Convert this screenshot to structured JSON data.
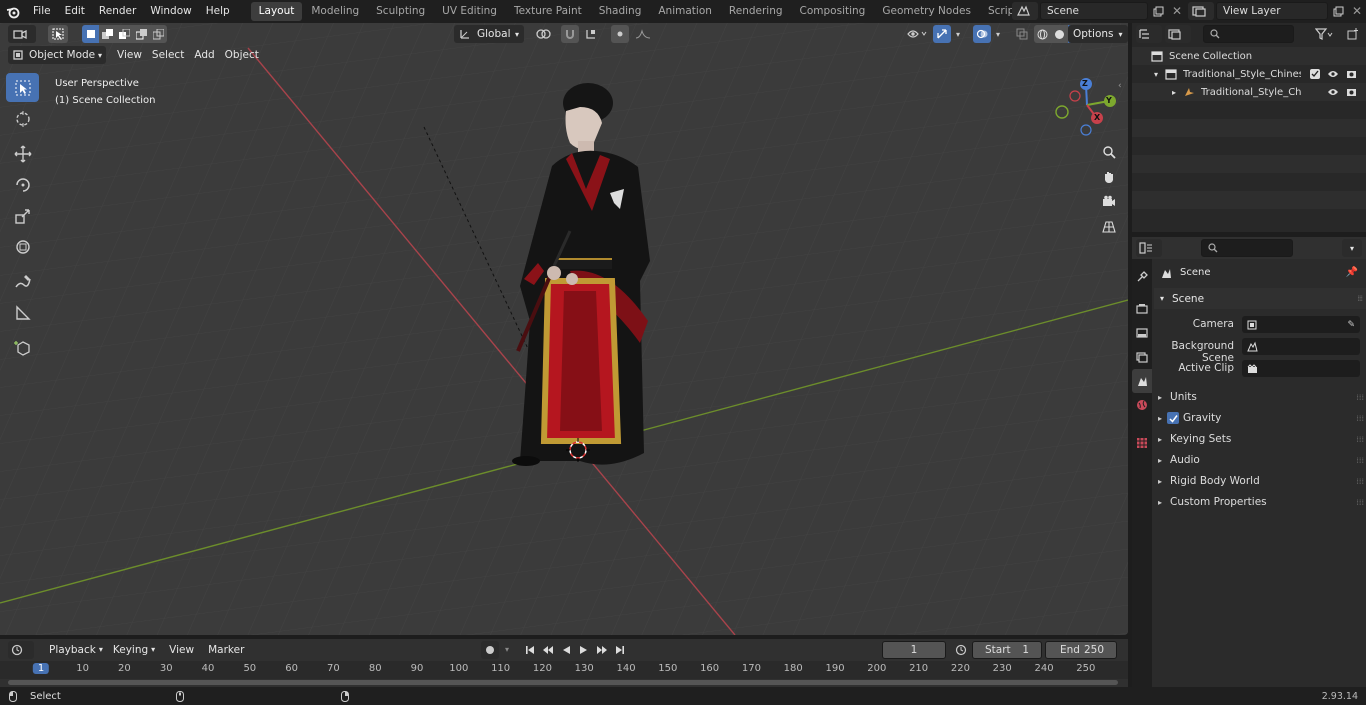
{
  "topbar": {
    "menus": [
      "File",
      "Edit",
      "Render",
      "Window",
      "Help"
    ],
    "workspaces": [
      "Layout",
      "Modeling",
      "Sculpting",
      "UV Editing",
      "Texture Paint",
      "Shading",
      "Animation",
      "Rendering",
      "Compositing",
      "Geometry Nodes",
      "Scripting"
    ],
    "active_workspace": "Layout",
    "scene_name": "Scene",
    "view_layer": "View Layer"
  },
  "viewport": {
    "mode": "Object Mode",
    "menus": [
      "View",
      "Select",
      "Add",
      "Object"
    ],
    "orientation": "Global",
    "options_label": "Options",
    "overlay_line1": "User Perspective",
    "overlay_line2": "(1) Scene Collection",
    "gizmo_axes": {
      "x": "X",
      "y": "Y",
      "z": "Z"
    }
  },
  "outliner": {
    "root": "Scene Collection",
    "items": [
      {
        "label": "Traditional_Style_Chinese_Ma",
        "type": "collection"
      },
      {
        "label": "Traditional_Style_Chinese",
        "type": "armature"
      }
    ]
  },
  "properties": {
    "context": "Scene",
    "section": "Scene",
    "fields": [
      {
        "label": "Camera",
        "icon": "camera-icon"
      },
      {
        "label": "Background Scene",
        "icon": "scene-icon"
      },
      {
        "label": "Active Clip",
        "icon": "clip-icon"
      }
    ],
    "panels": [
      "Units",
      "Gravity",
      "Keying Sets",
      "Audio",
      "Rigid Body World",
      "Custom Properties"
    ]
  },
  "timeline": {
    "menus": [
      "Playback",
      "Keying",
      "View",
      "Marker"
    ],
    "current_frame": "1",
    "start_label": "Start",
    "start_value": "1",
    "end_label": "End",
    "end_value": "250",
    "ruler": [
      "1",
      "10",
      "20",
      "30",
      "40",
      "50",
      "60",
      "70",
      "80",
      "90",
      "100",
      "110",
      "120",
      "130",
      "140",
      "150",
      "160",
      "170",
      "180",
      "190",
      "200",
      "210",
      "220",
      "230",
      "240",
      "250"
    ]
  },
  "status": {
    "left": "Select",
    "version": "2.93.14"
  },
  "colors": {
    "accent": "#4772b3",
    "x_axis": "#c8414b",
    "y_axis": "#7da82e",
    "z_axis": "#4a7fd6"
  }
}
